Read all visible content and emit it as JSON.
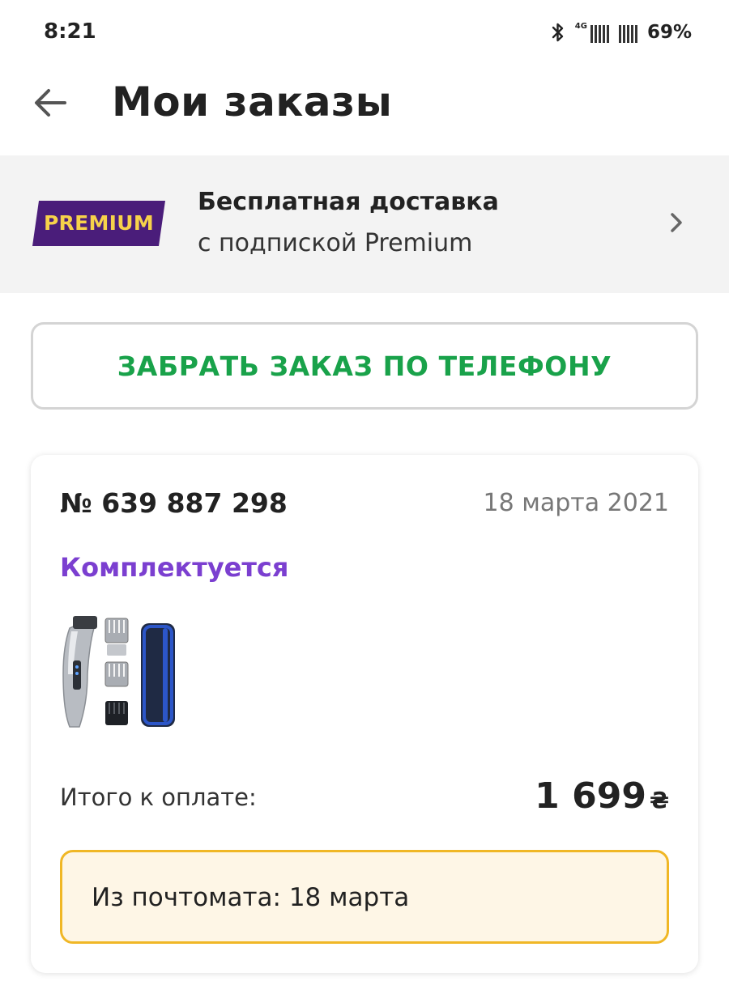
{
  "status_bar": {
    "time": "8:21",
    "network": "4G",
    "battery": "69%",
    "icons": [
      "bluetooth-icon",
      "signal-icon"
    ]
  },
  "header": {
    "title": "Мои заказы",
    "back_icon": "arrow-left-icon"
  },
  "premium_banner": {
    "badge": "PREMIUM",
    "title": "Бесплатная доставка",
    "subtitle": "с подпиской Premium",
    "chevron_icon": "chevron-right-icon",
    "badge_color": "#4a1d7a",
    "badge_text_color": "#f7d24a"
  },
  "pickup_button": {
    "label": "ЗАБРАТЬ ЗАКАЗ ПО ТЕЛЕФОНУ",
    "color": "#19a24a"
  },
  "order": {
    "number": "№ 639 887 298",
    "date": "18 марта 2021",
    "status": "Комплектуется",
    "status_color": "#7b3fd0",
    "product_image": "hair-clipper-kit-image",
    "total_label": "Итого к оплате:",
    "total_amount": "1 699",
    "currency": "₴",
    "pickup_info": "Из почтомата: 18 марта",
    "pickup_info_border_color": "#f0b726",
    "pickup_info_bg_color": "#fef6e6"
  }
}
